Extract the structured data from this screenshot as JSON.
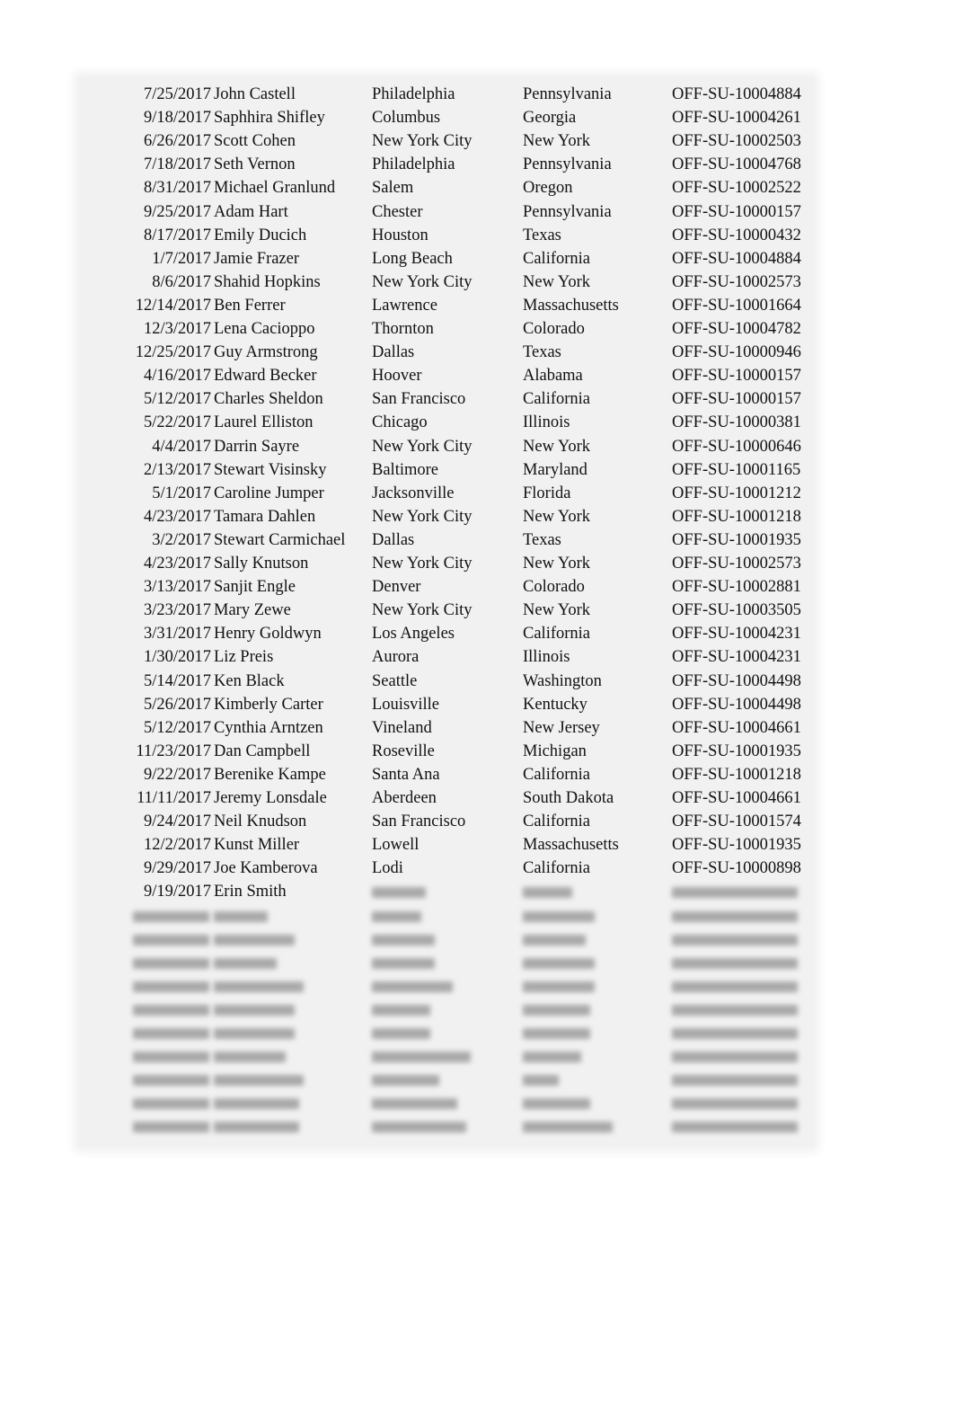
{
  "rows": [
    [
      "7/25/2017",
      "John Castell",
      "Philadelphia",
      "Pennsylvania",
      "OFF-SU-10004884"
    ],
    [
      "9/18/2017",
      "Saphhira Shifley",
      "Columbus",
      "Georgia",
      "OFF-SU-10004261"
    ],
    [
      "6/26/2017",
      "Scott Cohen",
      "New York City",
      "New York",
      "OFF-SU-10002503"
    ],
    [
      "7/18/2017",
      "Seth Vernon",
      "Philadelphia",
      "Pennsylvania",
      "OFF-SU-10004768"
    ],
    [
      "8/31/2017",
      "Michael Granlund",
      "Salem",
      "Oregon",
      "OFF-SU-10002522"
    ],
    [
      "9/25/2017",
      "Adam Hart",
      "Chester",
      "Pennsylvania",
      "OFF-SU-10000157"
    ],
    [
      "8/17/2017",
      "Emily Ducich",
      "Houston",
      "Texas",
      "OFF-SU-10000432"
    ],
    [
      "1/7/2017",
      "Jamie Frazer",
      "Long Beach",
      "California",
      "OFF-SU-10004884"
    ],
    [
      "8/6/2017",
      "Shahid Hopkins",
      "New York City",
      "New York",
      "OFF-SU-10002573"
    ],
    [
      "12/14/2017",
      "Ben Ferrer",
      "Lawrence",
      "Massachusetts",
      "OFF-SU-10001664"
    ],
    [
      "12/3/2017",
      "Lena Cacioppo",
      "Thornton",
      "Colorado",
      "OFF-SU-10004782"
    ],
    [
      "12/25/2017",
      "Guy Armstrong",
      "Dallas",
      "Texas",
      "OFF-SU-10000946"
    ],
    [
      "4/16/2017",
      "Edward Becker",
      "Hoover",
      "Alabama",
      "OFF-SU-10000157"
    ],
    [
      "5/12/2017",
      "Charles Sheldon",
      "San Francisco",
      "California",
      "OFF-SU-10000157"
    ],
    [
      "5/22/2017",
      "Laurel Elliston",
      "Chicago",
      "Illinois",
      "OFF-SU-10000381"
    ],
    [
      "4/4/2017",
      "Darrin Sayre",
      "New York City",
      "New York",
      "OFF-SU-10000646"
    ],
    [
      "2/13/2017",
      "Stewart Visinsky",
      "Baltimore",
      "Maryland",
      "OFF-SU-10001165"
    ],
    [
      "5/1/2017",
      "Caroline Jumper",
      "Jacksonville",
      "Florida",
      "OFF-SU-10001212"
    ],
    [
      "4/23/2017",
      "Tamara Dahlen",
      "New York City",
      "New York",
      "OFF-SU-10001218"
    ],
    [
      "3/2/2017",
      "Stewart Carmichael",
      "Dallas",
      "Texas",
      "OFF-SU-10001935"
    ],
    [
      "4/23/2017",
      "Sally Knutson",
      "New York City",
      "New York",
      "OFF-SU-10002573"
    ],
    [
      "3/13/2017",
      "Sanjit Engle",
      "Denver",
      "Colorado",
      "OFF-SU-10002881"
    ],
    [
      "3/23/2017",
      "Mary Zewe",
      "New York City",
      "New York",
      "OFF-SU-10003505"
    ],
    [
      "3/31/2017",
      "Henry Goldwyn",
      "Los Angeles",
      "California",
      "OFF-SU-10004231"
    ],
    [
      "1/30/2017",
      "Liz Preis",
      "Aurora",
      "Illinois",
      "OFF-SU-10004231"
    ],
    [
      "5/14/2017",
      "Ken Black",
      "Seattle",
      "Washington",
      "OFF-SU-10004498"
    ],
    [
      "5/26/2017",
      "Kimberly Carter",
      "Louisville",
      "Kentucky",
      "OFF-SU-10004498"
    ],
    [
      "5/12/2017",
      "Cynthia Arntzen",
      "Vineland",
      "New Jersey",
      "OFF-SU-10004661"
    ],
    [
      "11/23/2017",
      "Dan Campbell",
      "Roseville",
      "Michigan",
      "OFF-SU-10001935"
    ],
    [
      "9/22/2017",
      "Berenike Kampe",
      "Santa Ana",
      "California",
      "OFF-SU-10001218"
    ],
    [
      "11/11/2017",
      "Jeremy Lonsdale",
      "Aberdeen",
      "South Dakota",
      "OFF-SU-10004661"
    ],
    [
      "9/24/2017",
      "Neil Knudson",
      "San Francisco",
      "California",
      "OFF-SU-10001574"
    ],
    [
      "12/2/2017",
      "Kunst Miller",
      "Lowell",
      "Massachusetts",
      "OFF-SU-10001935"
    ],
    [
      "9/29/2017",
      "Joe Kamberova",
      "Lodi",
      "California",
      "OFF-SU-10000898"
    ],
    [
      "9/19/2017",
      "Erin Smith",
      "",
      "",
      ""
    ]
  ]
}
